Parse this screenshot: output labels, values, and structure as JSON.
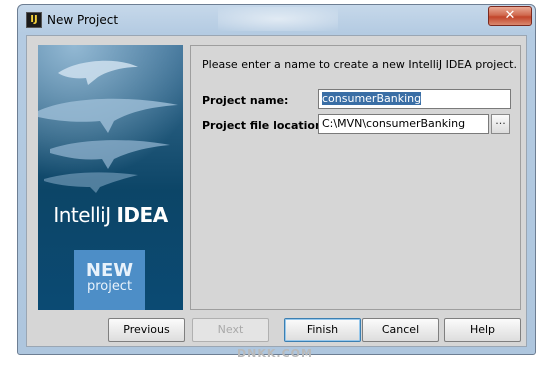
{
  "window": {
    "title": "New Project",
    "app_icon": "intellij-app-icon",
    "close_glyph": "✕"
  },
  "banner": {
    "logo_light": "IntelliJ ",
    "logo_bold": "IDEA",
    "badge_new": "NEW",
    "badge_project": "project"
  },
  "form": {
    "prompt": "Please enter a name to create a new IntelliJ IDEA project.",
    "project_name_label": "Project name:",
    "project_name_value": "consumerBanking",
    "project_location_label": "Project file location:",
    "project_location_value": "C:\\MVN\\consumerBanking",
    "browse_label": "..."
  },
  "buttons": {
    "previous": "Previous",
    "next": "Next",
    "finish": "Finish",
    "cancel": "Cancel",
    "help": "Help"
  },
  "watermark": "DNKK.COM"
}
